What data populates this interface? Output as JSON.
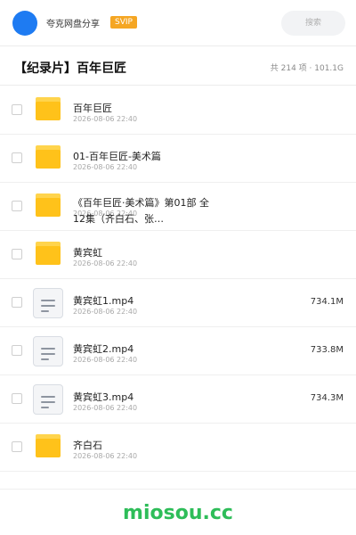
{
  "header": {
    "sharer_name": "夸克网盘分享",
    "badge": "SVIP",
    "search_placeholder": "搜索"
  },
  "folder": {
    "title": "【纪录片】百年巨匠",
    "summary": "共 214 项 · 101.1G"
  },
  "files": [
    {
      "type": "folder",
      "icon": "folder-icon",
      "name": "百年巨匠",
      "date": "2026-08-06 22:40",
      "size": ""
    },
    {
      "type": "folder",
      "icon": "folder-icon",
      "name": "01-百年巨匠-美术篇",
      "date": "2026-08-06 22:40",
      "size": ""
    },
    {
      "type": "folder",
      "icon": "folder-icon",
      "name": "《百年巨匠·美术篇》第01部 全12集（齐白石、张…",
      "date": "2026-08-06 22:40",
      "size": ""
    },
    {
      "type": "folder",
      "icon": "folder-icon",
      "name": "黄宾虹",
      "date": "2026-08-06 22:40",
      "size": ""
    },
    {
      "type": "file",
      "icon": "video-file-icon",
      "name": "黄宾虹1.mp4",
      "date": "2026-08-06 22:40",
      "size": "734.1M"
    },
    {
      "type": "file",
      "icon": "video-file-icon",
      "name": "黄宾虹2.mp4",
      "date": "2026-08-06 22:40",
      "size": "733.8M"
    },
    {
      "type": "file",
      "icon": "video-file-icon",
      "name": "黄宾虹3.mp4",
      "date": "2026-08-06 22:40",
      "size": "734.3M"
    },
    {
      "type": "folder",
      "icon": "folder-icon",
      "name": "齐白石",
      "date": "2026-08-06 22:40",
      "size": ""
    }
  ],
  "footer": {
    "watermark": "miosou.cc"
  },
  "colors": {
    "avatar": "#1e7bf2",
    "badge": "#f5a623",
    "folder": "#ffc21a",
    "watermark": "#2ebd59"
  }
}
